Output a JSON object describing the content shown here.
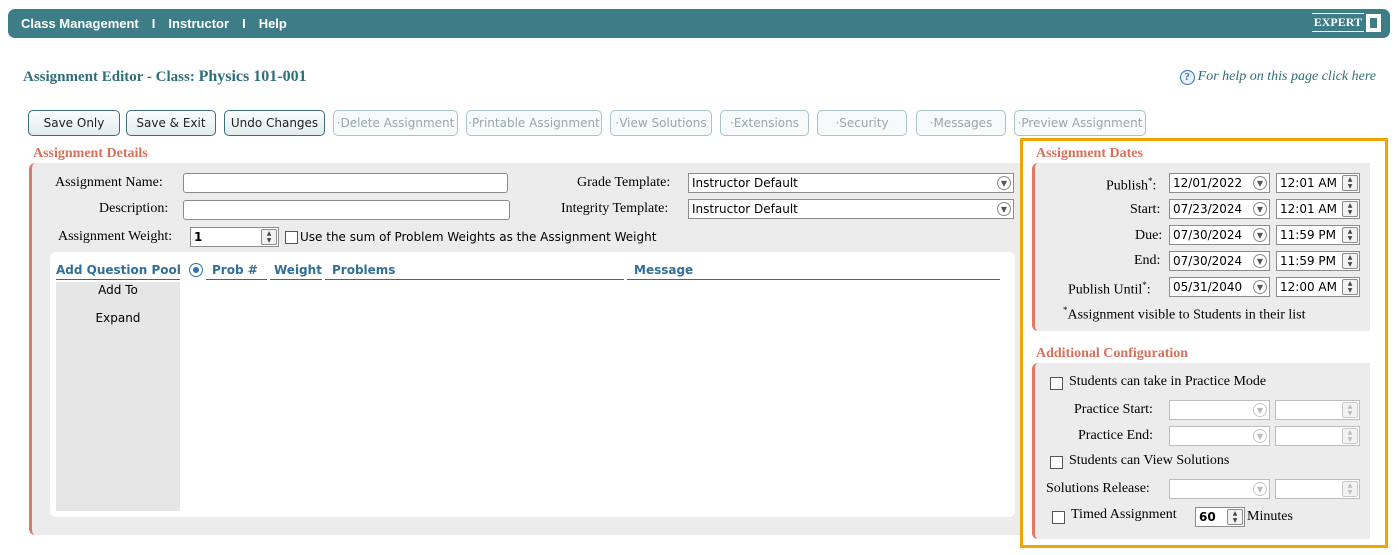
{
  "nav": {
    "items": [
      "Class Management",
      "Instructor",
      "Help"
    ],
    "separator": "I",
    "logo_text": "EXPERT"
  },
  "header": {
    "title_prefix": "Assignment Editor - Class:",
    "class_name": "Physics 101-001",
    "help_text": "For help on this page click here",
    "help_icon": "?"
  },
  "toolbar": {
    "buttons": [
      {
        "label": "Save Only",
        "enabled": true
      },
      {
        "label": "Save & Exit",
        "enabled": true
      },
      {
        "label": "Undo Changes",
        "enabled": true
      },
      {
        "label": "·Delete Assignment",
        "enabled": false
      },
      {
        "label": "·Printable Assignment",
        "enabled": false
      },
      {
        "label": "·View Solutions",
        "enabled": false
      },
      {
        "label": "·Extensions",
        "enabled": false
      },
      {
        "label": "·Security",
        "enabled": false
      },
      {
        "label": "·Messages",
        "enabled": false
      },
      {
        "label": "·Preview Assignment",
        "enabled": false
      }
    ]
  },
  "details": {
    "title": "Assignment Details",
    "name_label": "Assignment Name:",
    "name_value": "",
    "description_label": "Description:",
    "description_value": "",
    "grade_template_label": "Grade Template:",
    "grade_template_value": "Instructor Default",
    "integrity_template_label": "Integrity Template:",
    "integrity_template_value": "Instructor Default",
    "weight_label": "Assignment Weight:",
    "weight_value": "1",
    "sum_weights_label": "Use the sum of Problem Weights as the Assignment Weight",
    "sum_weights_checked": false
  },
  "problems": {
    "add_pool_label": "Add Question Pool",
    "columns": [
      "Prob #",
      "Weight",
      "Problems",
      "Message"
    ],
    "side_actions": [
      "Add To",
      "Expand"
    ]
  },
  "dates": {
    "title": "Assignment Dates",
    "rows": [
      {
        "label": "Publish",
        "star": "*",
        "date": "12/01/2022",
        "time": "12:01 AM"
      },
      {
        "label": "Start:",
        "star": "",
        "date": "07/23/2024",
        "time": "12:01 AM"
      },
      {
        "label": "Due:",
        "star": "",
        "date": "07/30/2024",
        "time": "11:59 PM"
      },
      {
        "label": "End:",
        "star": "",
        "date": "07/30/2024",
        "time": "11:59 PM"
      },
      {
        "label": "Publish Until",
        "star": "*",
        "date": "05/31/2040",
        "time": "12:00 AM"
      }
    ],
    "colon": ":",
    "footnote_star": "*",
    "footnote": "Assignment visible to Students in their list"
  },
  "config": {
    "title": "Additional Configuration",
    "practice_mode_label": "Students can take in Practice Mode",
    "practice_start_label": "Practice Start:",
    "practice_end_label": "Practice End:",
    "view_solutions_label": "Students can View Solutions",
    "solutions_release_label": "Solutions Release:",
    "timed_label": "Timed Assignment",
    "timed_minutes": "60",
    "minutes_label": "Minutes"
  },
  "colors": {
    "nav_bg": "#3d7d87",
    "section_title": "#d9705a",
    "highlight": "#f0a500"
  }
}
